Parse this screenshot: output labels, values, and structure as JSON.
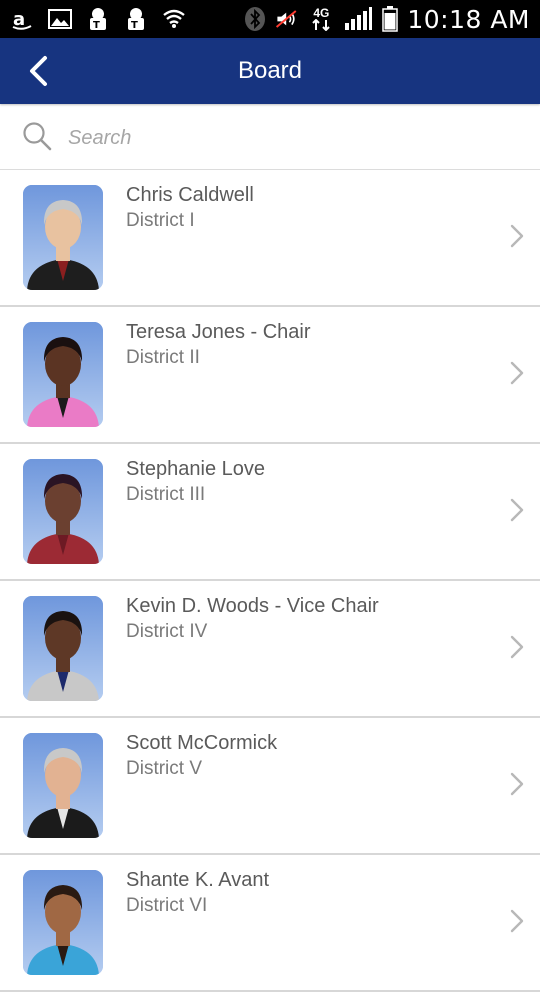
{
  "status_bar": {
    "time": "10:18 AM",
    "network": "4G",
    "left_icons": [
      "amazon-icon",
      "image-icon",
      "tmobile-icon",
      "tmobile-icon",
      "wifi-icon"
    ],
    "right_icons": [
      "bluetooth-icon",
      "mute-icon",
      "signal-icon",
      "battery-icon"
    ]
  },
  "app_bar": {
    "title": "Board",
    "back_icon": "chevron-left-icon",
    "color": "#173480"
  },
  "search": {
    "placeholder": "Search",
    "value": ""
  },
  "members": [
    {
      "name": "Chris Caldwell",
      "district": "District I",
      "skin": "#e8c2a0",
      "hair": "#c8c8c8",
      "top": "#1e1e1e",
      "accent": "#8b1f1f"
    },
    {
      "name": "Teresa Jones - Chair",
      "district": "District II",
      "skin": "#5b3423",
      "hair": "#1a1010",
      "top": "#ea7bc6",
      "accent": "#1b1b1b"
    },
    {
      "name": "Stephanie Love",
      "district": "District III",
      "skin": "#6b4030",
      "hair": "#2a1424",
      "top": "#9c2a34",
      "accent": "#6d1a24"
    },
    {
      "name": "Kevin D. Woods - Vice Chair",
      "district": "District IV",
      "skin": "#5e3826",
      "hair": "#1a1210",
      "top": "#c8c8c8",
      "accent": "#1d2a6b"
    },
    {
      "name": "Scott McCormick",
      "district": "District V",
      "skin": "#e2b292",
      "hair": "#c8c8c8",
      "top": "#1b1b1b",
      "accent": "#e6e6e6"
    },
    {
      "name": "Shante K. Avant",
      "district": "District VI",
      "skin": "#a06844",
      "hair": "#2a1a12",
      "top": "#3aa4d8",
      "accent": "#2a1a12"
    }
  ]
}
